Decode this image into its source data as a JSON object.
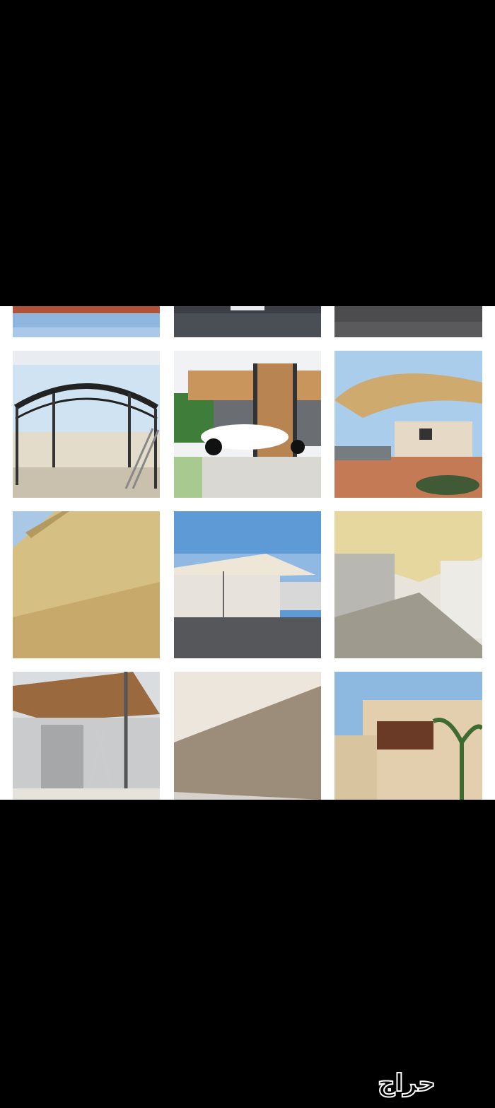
{
  "photos": [
    {
      "name": "photo-red-tile-roof-top"
    },
    {
      "name": "photo-garage-top"
    },
    {
      "name": "photo-gray-top"
    },
    {
      "name": "photo-arched-pergola-frame"
    },
    {
      "name": "photo-wood-lattice-car-shade"
    },
    {
      "name": "photo-fabric-canopy-parking"
    },
    {
      "name": "photo-beige-wall-cladding"
    },
    {
      "name": "photo-flat-car-shade"
    },
    {
      "name": "photo-fabric-shade-corridor"
    },
    {
      "name": "photo-pergola-under-construction"
    },
    {
      "name": "photo-louvered-wall-panels"
    },
    {
      "name": "photo-villa-with-palm"
    }
  ],
  "watermark": {
    "text": "حراج",
    "color": "#ffffff"
  },
  "colors": {
    "background": "#000000",
    "grid": "#ffffff"
  }
}
